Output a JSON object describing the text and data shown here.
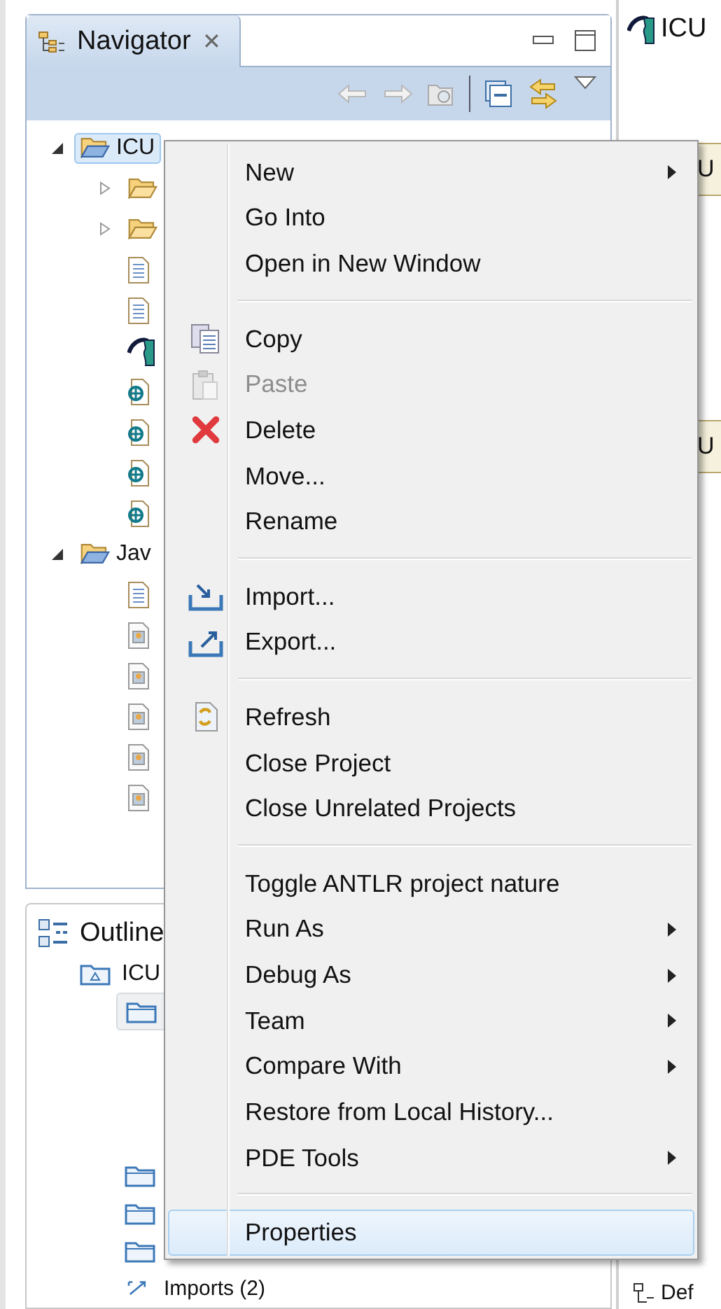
{
  "navigator": {
    "tab": {
      "title": "Navigator",
      "close": "✕",
      "selected": true
    },
    "tree": [
      {
        "label": "ICU",
        "kind": "project",
        "expanded": true,
        "selected": true,
        "children": [
          {
            "kind": "folder",
            "expanded": false
          },
          {
            "kind": "folder",
            "expanded": false
          },
          {
            "kind": "file"
          },
          {
            "kind": "file"
          },
          {
            "kind": "antlr"
          },
          {
            "kind": "source"
          },
          {
            "kind": "source"
          },
          {
            "kind": "source"
          },
          {
            "kind": "source"
          }
        ]
      },
      {
        "label": "Jav",
        "kind": "project",
        "expanded": true,
        "selected": false,
        "children": [
          {
            "kind": "file"
          },
          {
            "kind": "image"
          },
          {
            "kind": "image"
          },
          {
            "kind": "image"
          },
          {
            "kind": "image"
          },
          {
            "kind": "image"
          }
        ]
      }
    ]
  },
  "outline": {
    "tab": {
      "title": "Outline"
    },
    "tree": [
      {
        "label": "ICU",
        "kind": "unit",
        "selected": false
      },
      {
        "kind": "package",
        "selected": true
      },
      {
        "kind": "package",
        "selected": false
      },
      {
        "kind": "package",
        "selected": false
      },
      {
        "kind": "package",
        "selected": false
      },
      {
        "label": "Imports (2)",
        "kind": "imports",
        "selected": false
      }
    ]
  },
  "editor": {
    "title": "ICU",
    "fragments": [
      "U",
      "U"
    ],
    "bottom_label": "Def"
  },
  "context_menu": [
    {
      "kind": "item",
      "label": "New",
      "submenu": true
    },
    {
      "kind": "item",
      "label": "Go Into"
    },
    {
      "kind": "item",
      "label": "Open in New Window"
    },
    {
      "kind": "separator"
    },
    {
      "kind": "item",
      "label": "Copy"
    },
    {
      "kind": "item",
      "label": "Paste",
      "disabled": true
    },
    {
      "kind": "item",
      "label": "Delete"
    },
    {
      "kind": "item",
      "label": "Move..."
    },
    {
      "kind": "item",
      "label": "Rename"
    },
    {
      "kind": "separator"
    },
    {
      "kind": "item",
      "label": "Import..."
    },
    {
      "kind": "item",
      "label": "Export..."
    },
    {
      "kind": "separator"
    },
    {
      "kind": "item",
      "label": "Refresh"
    },
    {
      "kind": "item",
      "label": "Close Project"
    },
    {
      "kind": "item",
      "label": "Close Unrelated Projects"
    },
    {
      "kind": "separator"
    },
    {
      "kind": "item",
      "label": "Toggle ANTLR project nature"
    },
    {
      "kind": "item",
      "label": "Run As",
      "submenu": true
    },
    {
      "kind": "item",
      "label": "Debug As",
      "submenu": true
    },
    {
      "kind": "item",
      "label": "Team",
      "submenu": true
    },
    {
      "kind": "item",
      "label": "Compare With",
      "submenu": true
    },
    {
      "kind": "item",
      "label": "Restore from Local History..."
    },
    {
      "kind": "item",
      "label": "PDE Tools",
      "submenu": true
    },
    {
      "kind": "separator"
    },
    {
      "kind": "item",
      "label": "Properties",
      "selected": true
    }
  ]
}
